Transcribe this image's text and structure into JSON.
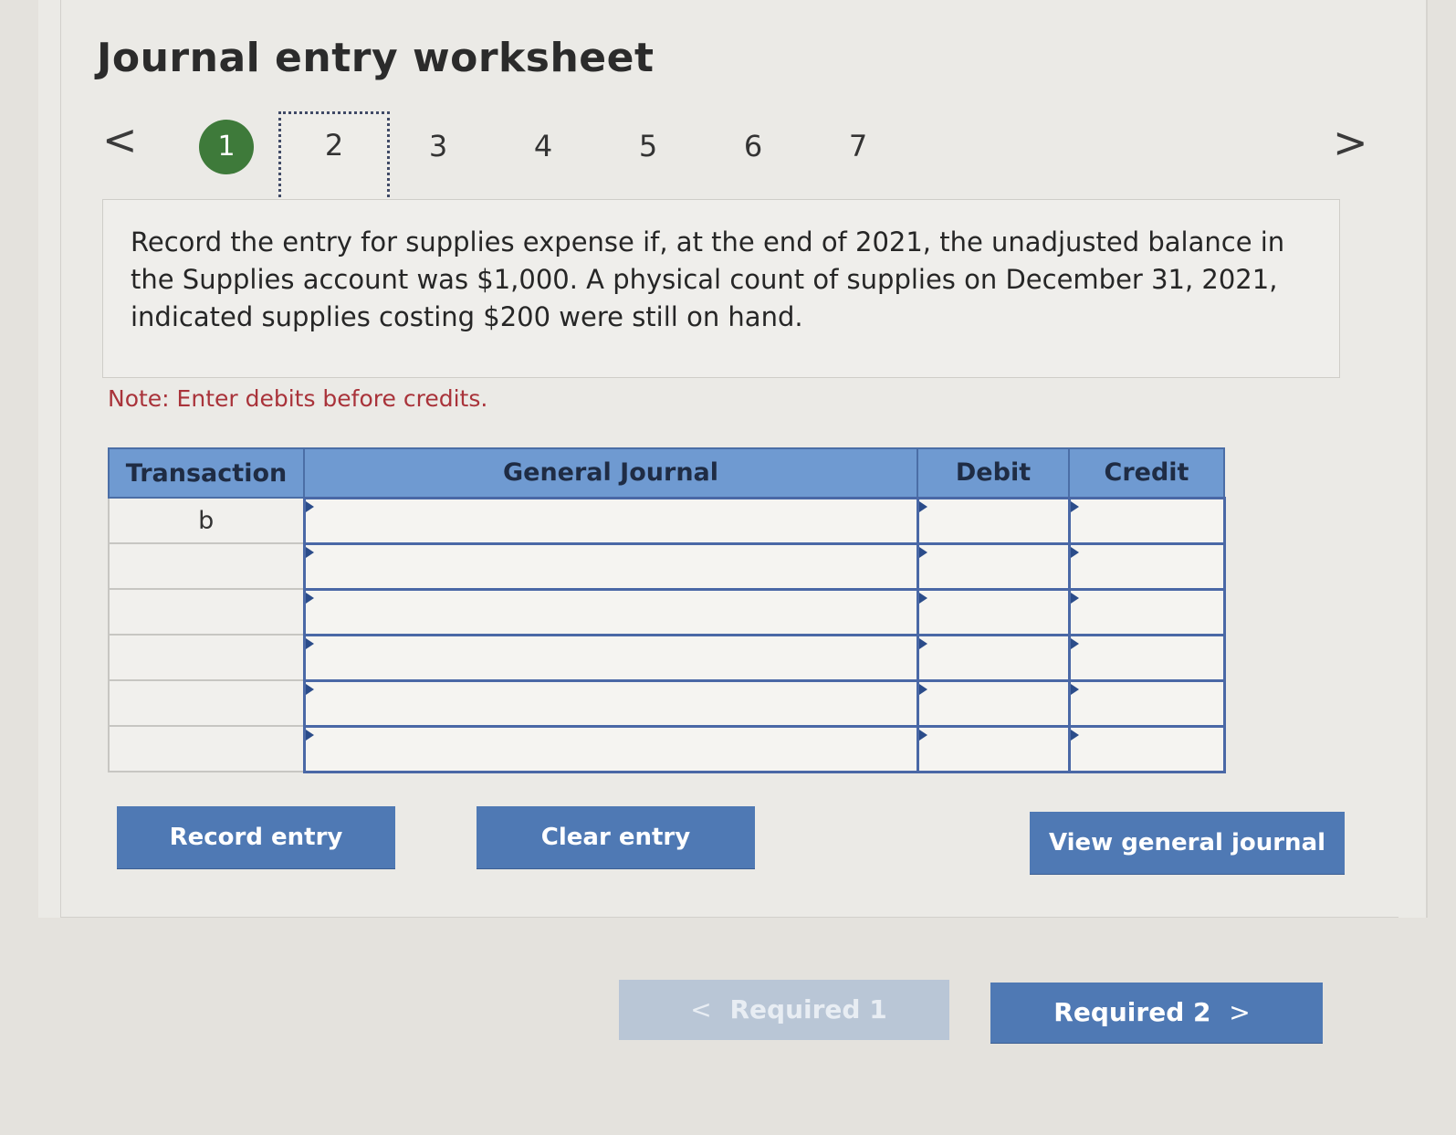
{
  "header": {
    "title": "Journal entry worksheet"
  },
  "nav": {
    "prev_icon": "chevron-left-icon",
    "next_icon": "chevron-right-icon",
    "prev_glyph": "<",
    "next_glyph": ">",
    "steps": [
      "1",
      "2",
      "3",
      "4",
      "5",
      "6",
      "7"
    ],
    "completed_step": "1",
    "current_step": "2"
  },
  "question": {
    "text": "Record the entry for supplies expense if, at the end of 2021, the unadjusted balance in the Supplies account was $1,000. A physical count of supplies on December 31, 2021, indicated supplies costing $200 were still on hand."
  },
  "note": "Note: Enter debits before credits.",
  "table": {
    "headers": [
      "Transaction",
      "General Journal",
      "Debit",
      "Credit"
    ],
    "rows": [
      {
        "transaction": "b",
        "account": "",
        "debit": "",
        "credit": ""
      },
      {
        "transaction": "",
        "account": "",
        "debit": "",
        "credit": ""
      },
      {
        "transaction": "",
        "account": "",
        "debit": "",
        "credit": ""
      },
      {
        "transaction": "",
        "account": "",
        "debit": "",
        "credit": ""
      },
      {
        "transaction": "",
        "account": "",
        "debit": "",
        "credit": ""
      },
      {
        "transaction": "",
        "account": "",
        "debit": "",
        "credit": ""
      }
    ]
  },
  "buttons": {
    "record": "Record entry",
    "clear": "Clear entry",
    "view": "View general journal",
    "required1": "Required 1",
    "required2": "Required 2",
    "chev_left": "<",
    "chev_right": ">"
  },
  "colors": {
    "accent": "#4f79b4",
    "header_fill": "#6f9ad1",
    "completed_step": "#3e7a3a",
    "note_text": "#a9333a"
  }
}
